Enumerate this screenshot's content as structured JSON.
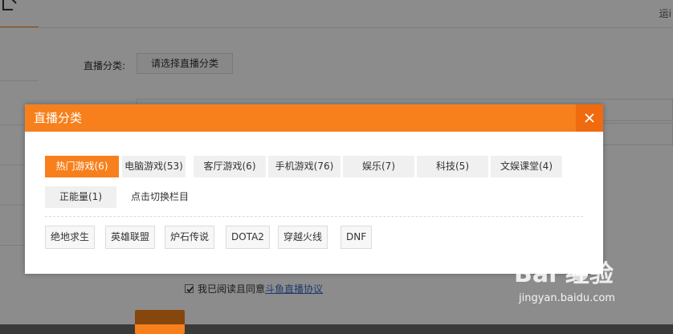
{
  "background": {
    "top_right_text": "运i",
    "field_label": "直播分类:",
    "category_button": "请选择直播分类",
    "agree_prefix": "我已阅读且同意",
    "agree_link": "斗鱼直播协议"
  },
  "modal": {
    "title": "直播分类",
    "tabs": [
      {
        "label": "热门游戏(6)",
        "active": true
      },
      {
        "label": "电脑游戏(53)",
        "active": false
      },
      {
        "label": "客厅游戏(6)",
        "active": false
      },
      {
        "label": "手机游戏(76)",
        "active": false
      },
      {
        "label": "娱乐(7)",
        "active": false
      },
      {
        "label": "科技(5)",
        "active": false
      },
      {
        "label": "文娱课堂(4)",
        "active": false
      },
      {
        "label": "正能量(1)",
        "active": false
      }
    ],
    "switch_hint": "点击切换栏目",
    "games": [
      "绝地求生",
      "英雄联盟",
      "炉石传说",
      "DOTA2",
      "穿越火线",
      "DNF"
    ]
  },
  "watermark": {
    "brand": "Bai 经验",
    "url": "jingyan.baidu.com"
  },
  "colors": {
    "accent": "#f7801c",
    "close_bg": "#f06a0f",
    "link": "#3a6fc7"
  }
}
